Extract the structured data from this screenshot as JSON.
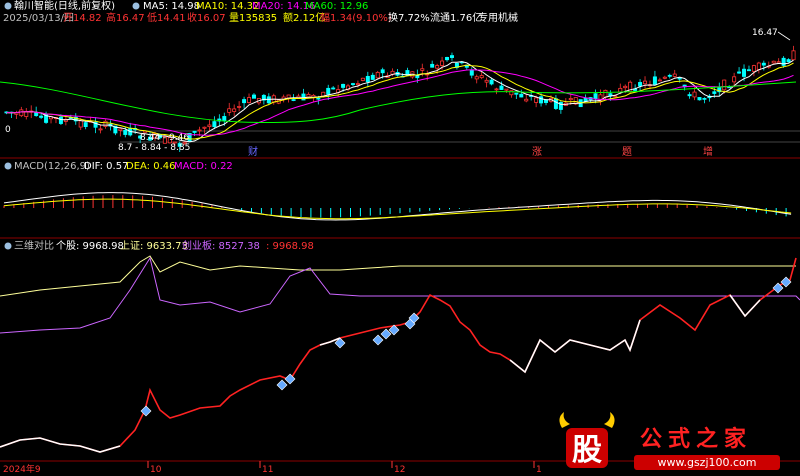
{
  "header": {
    "stock_name": "翰川智能(日线,前复权)",
    "ma_labels": [
      {
        "text": "MA5: 14.98",
        "color": "#ffffff"
      },
      {
        "text": "MA10: 14.32",
        "color": "#ffff00"
      },
      {
        "text": "MA20: 14.16",
        "color": "#ff00ff"
      },
      {
        "text": "MA60: 12.96",
        "color": "#00ff00"
      }
    ],
    "quote_items": [
      {
        "text": "2025/03/13/四",
        "color": "#c0c0c0"
      },
      {
        "text": "开14.82",
        "color": "#ff3333"
      },
      {
        "text": "高16.47",
        "color": "#ff3333"
      },
      {
        "text": "低14.41",
        "color": "#ff3333"
      },
      {
        "text": "收16.07",
        "color": "#ff3333"
      },
      {
        "text": "量135835",
        "color": "#ffff00"
      },
      {
        "text": "额2.12亿",
        "color": "#ffff00"
      },
      {
        "text": "幅1.34(9.10%)",
        "color": "#ff3333"
      },
      {
        "text": "换7.72%",
        "color": "#ffffff"
      },
      {
        "text": "流通1.76亿",
        "color": "#ffffff"
      },
      {
        "text": "专用机械",
        "color": "#ffffff"
      }
    ],
    "high_marker": "16.47",
    "low_markers": [
      "8.44 - 9.46",
      "8.7 - 8.84 - 8.85"
    ],
    "low_price_label": "0"
  },
  "event_tags": [
    {
      "text": "财",
      "color": "#6666ff"
    },
    {
      "text": "涨",
      "color": "#ff4444"
    },
    {
      "text": "题",
      "color": "#ff4444"
    },
    {
      "text": "增",
      "color": "#ff4444"
    }
  ],
  "macd_panel": {
    "title": "MACD(12,26,9)",
    "dif": "DIF: 0.57",
    "dea": "DEA: 0.46",
    "macd": "MACD: 0.22",
    "colors": {
      "dif": "#ffffff",
      "dea": "#ffff00",
      "macd": "#ff00ff"
    }
  },
  "compare_panel": {
    "title": "三维对比",
    "stock": "个股: 9968.98",
    "sh": "上证: 9633.73",
    "cyb": "创业板: 8527.38",
    "value": ": 9968.98",
    "colors": {
      "stock": "#ffffff",
      "sh": "#ffff99",
      "cyb": "#cc66ff",
      "value": "#ff3333"
    }
  },
  "x_axis": [
    "2024年9",
    "10",
    "11",
    "12",
    "1"
  ],
  "watermark": {
    "logo_char": "股",
    "brand": "公式之家",
    "url": "www.gszj100.com"
  },
  "colors": {
    "up": "#ff3333",
    "down": "#00ffff",
    "grid": "#8b0000"
  }
}
